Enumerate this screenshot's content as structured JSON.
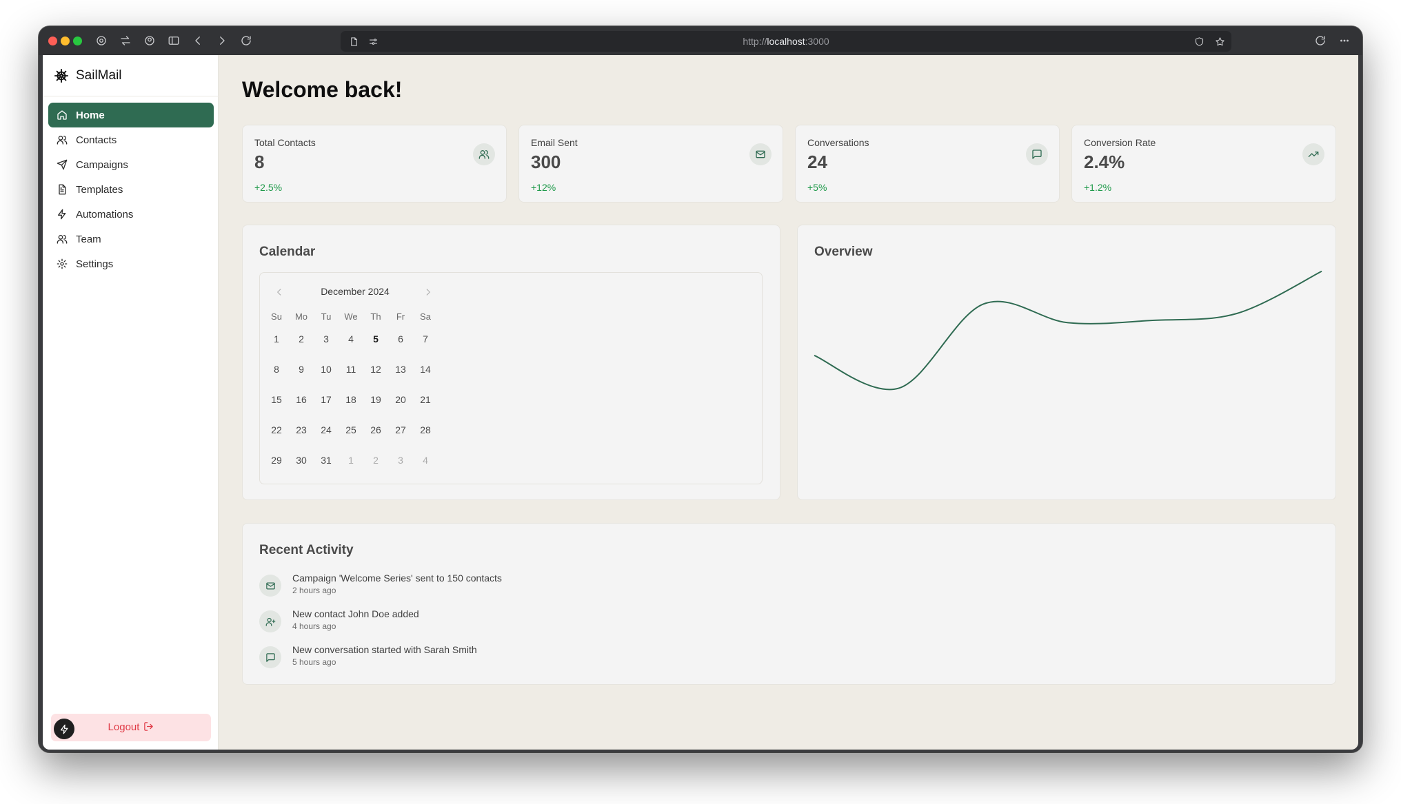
{
  "browser": {
    "url_scheme": "http://",
    "url_host": "localhost",
    "url_port": ":3000"
  },
  "app": {
    "name": "SailMail",
    "accent_color": "#2f6b52"
  },
  "sidebar": {
    "items": [
      {
        "label": "Home",
        "icon": "home-icon",
        "active": true
      },
      {
        "label": "Contacts",
        "icon": "users-icon"
      },
      {
        "label": "Campaigns",
        "icon": "send-icon"
      },
      {
        "label": "Templates",
        "icon": "file-text-icon"
      },
      {
        "label": "Automations",
        "icon": "zap-icon"
      },
      {
        "label": "Team",
        "icon": "team-icon"
      },
      {
        "label": "Settings",
        "icon": "settings-icon"
      }
    ],
    "logout_label": "Logout"
  },
  "main": {
    "title": "Welcome back!",
    "stats": [
      {
        "label": "Total Contacts",
        "value": "8",
        "change": "+2.5%",
        "icon": "users-icon"
      },
      {
        "label": "Email Sent",
        "value": "300",
        "change": "+12%",
        "icon": "mail-icon"
      },
      {
        "label": "Conversations",
        "value": "24",
        "change": "+5%",
        "icon": "message-square-icon"
      },
      {
        "label": "Conversion Rate",
        "value": "2.4%",
        "change": "+1.2%",
        "icon": "trending-up-icon"
      }
    ],
    "calendar": {
      "title": "Calendar",
      "month": "December 2024",
      "weekdays": [
        "Su",
        "Mo",
        "Tu",
        "We",
        "Th",
        "Fr",
        "Sa"
      ],
      "weeks": [
        [
          "1",
          "2",
          "3",
          "4",
          "5",
          "6",
          "7"
        ],
        [
          "8",
          "9",
          "10",
          "11",
          "12",
          "13",
          "14"
        ],
        [
          "15",
          "16",
          "17",
          "18",
          "19",
          "20",
          "21"
        ],
        [
          "22",
          "23",
          "24",
          "25",
          "26",
          "27",
          "28"
        ],
        [
          "29",
          "30",
          "31",
          "1",
          "2",
          "3",
          "4"
        ]
      ],
      "today": "5"
    },
    "overview": {
      "title": "Overview"
    },
    "recent_activity": {
      "title": "Recent Activity",
      "items": [
        {
          "text": "Campaign 'Welcome Series' sent to 150 contacts",
          "time": "2 hours ago",
          "icon": "mail-icon"
        },
        {
          "text": "New contact John Doe added",
          "time": "4 hours ago",
          "icon": "user-plus-icon"
        },
        {
          "text": "New conversation started with Sarah Smith",
          "time": "5 hours ago",
          "icon": "message-square-icon"
        }
      ]
    }
  },
  "chart_data": {
    "type": "line",
    "title": "",
    "xlabel": "",
    "ylabel": "",
    "x": [
      1,
      2,
      3,
      4,
      5,
      6,
      7
    ],
    "series": [
      {
        "values": [
          3.1,
          2.4,
          4.2,
          3.8,
          3.85,
          4.0,
          4.9
        ]
      }
    ],
    "ylim": [
      2.2,
      5.0
    ],
    "grid": false,
    "color": "#2f6b52"
  }
}
